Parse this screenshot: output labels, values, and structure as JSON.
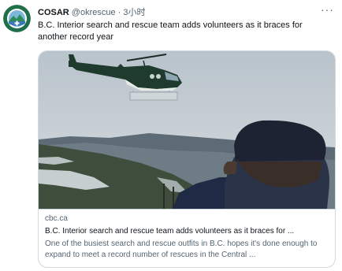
{
  "tweet": {
    "author_name": "COSAR",
    "handle": "@okrescue",
    "separator": "·",
    "time": "3小时",
    "more_label": "···",
    "text": "B.C. Interior search and rescue team adds volunteers as it braces for another record year"
  },
  "card": {
    "domain": "cbc.ca",
    "title": "B.C. Interior search and rescue team adds volunteers as it braces for ...",
    "description": "One of the busiest search and rescue outfits in B.C. hopes it's done enough to expand to meet a record number of rescues in the Central ..."
  },
  "colors": {
    "secondary_text": "#536471",
    "primary_text": "#0f1419",
    "border": "#cfd9de",
    "avatar_green": "#1f6f4a"
  }
}
